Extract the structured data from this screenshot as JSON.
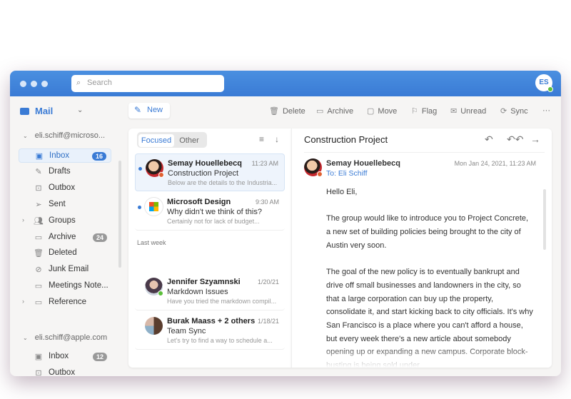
{
  "search": {
    "placeholder": "Search"
  },
  "user": {
    "initials": "ES"
  },
  "sidebar": {
    "app": "Mail",
    "accounts": [
      {
        "email": "eli.schiff@microso...",
        "folders": [
          {
            "label": "Inbox",
            "icon": "inbox-icon",
            "count": "16",
            "selected": true
          },
          {
            "label": "Drafts",
            "icon": "pencil-icon"
          },
          {
            "label": "Outbox",
            "icon": "outbox-icon"
          },
          {
            "label": "Sent",
            "icon": "send-icon"
          },
          {
            "label": "Groups",
            "icon": "people-icon",
            "expandable": true
          },
          {
            "label": "Archive",
            "icon": "archive-icon",
            "count": "24"
          },
          {
            "label": "Deleted",
            "icon": "trash-icon"
          },
          {
            "label": "Junk Email",
            "icon": "junk-folder-icon"
          },
          {
            "label": "Meetings Note...",
            "icon": "folder-icon"
          },
          {
            "label": "Reference",
            "icon": "folder-icon",
            "expandable": true
          }
        ]
      },
      {
        "email": "eli.schiff@apple.com",
        "folders": [
          {
            "label": "Inbox",
            "icon": "inbox-icon",
            "count": "12"
          },
          {
            "label": "Outbox",
            "icon": "outbox-icon"
          }
        ]
      }
    ]
  },
  "toolbar": {
    "new": "New",
    "delete": "Delete",
    "archive": "Archive",
    "move": "Move",
    "flag": "Flag",
    "unread": "Unread",
    "sync": "Sync",
    "more": "···"
  },
  "list": {
    "tabs": {
      "focused": "Focused",
      "other": "Other"
    },
    "group_last_week": "Last week",
    "messages": [
      {
        "from": "Semay Houellebecq",
        "time": "11:23 AM",
        "subject": "Construction Project",
        "preview": "Below are the details to the Industria...",
        "unread": true
      },
      {
        "from": "Microsoft Design",
        "time": "9:30 AM",
        "subject": "Why didn't we think of this?",
        "preview": "Certainly not for lack of budget...",
        "unread": true
      },
      {
        "from": "Jennifer Szyamnski",
        "time": "1/20/21",
        "subject": "Markdown Issues",
        "preview": "Have you tried the markdown compil..."
      },
      {
        "from": "Burak Maass + 2 others",
        "time": "1/18/21",
        "subject": "Team Sync",
        "preview": "Let's try to find a way to schedule a..."
      }
    ]
  },
  "reading": {
    "title": "Construction Project",
    "from": "Semay Houellebecq",
    "to": "To: Eli Schiff",
    "date": "Mon Jan 24, 2021, 11:23 AM",
    "paragraphs": [
      "Hello Eli,",
      "The group would like to introduce you to Project Concrete, a new set of building policies being brought to the city of Austin very soon.",
      "The goal of the new policy is to eventually bankrupt and drive off small businesses and landowners in the city, so that a large corporation can buy up the property, consolidate it, and start kicking back to city officials. It's why San Francisco is a place where you can't afford a house, but every week there's a new article about somebody opening up or expanding a new campus. Corporate block-busting is being sold under"
    ]
  },
  "colors": {
    "accent": "#3a7bd5",
    "titlebar": "#4a8fe0"
  }
}
